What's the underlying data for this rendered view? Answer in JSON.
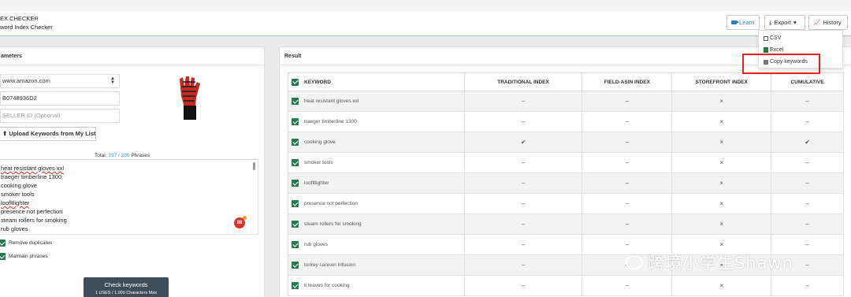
{
  "header": {
    "title": "EX CHECKER",
    "subtitle": "word Index Checker",
    "learn_label": "Learn",
    "export_label": "Export",
    "history_label": "History"
  },
  "export_menu": {
    "items": [
      "CSV",
      "Excel",
      "Copy keywords"
    ]
  },
  "parameters": {
    "title": "ameters",
    "marketplace": "www.amazon.com",
    "asin": "B0748936D2",
    "seller_placeholder": "SELLER ID (Optional)",
    "upload_label": "Upload Keywords from My List",
    "total_prefix": "Total:",
    "total_used": "197",
    "total_sep": " / ",
    "total_max": "200",
    "total_suffix": "Phrases",
    "keywords_text": [
      "heat resistant gloves xxl",
      "traeger timberline 1300",
      "cooking glove",
      "smoker tools",
      "loofltlighter",
      "presence not perfection",
      "steam rollers for smoking",
      "rub gloves"
    ],
    "badge": "88",
    "remove_duplicates_label": "Remove duplicates",
    "maintain_phrases_label": "Maintain phrases",
    "check_button": {
      "label": "Check keywords",
      "sublabel": "1 USES / 1,000 Characters Max"
    }
  },
  "result": {
    "title": "Result",
    "columns": [
      "KEYWORD",
      "TRADITIONAL INDEX",
      "FIELD-ASIN INDEX",
      "STOREFRONT INDEX",
      "CUMULATIVE"
    ],
    "rows": [
      {
        "keyword": "heat resistant gloves xxl",
        "traditional": "–",
        "field_asin": "–",
        "storefront": "×",
        "cumulative": "–"
      },
      {
        "keyword": "traeger timberline 1300",
        "traditional": "–",
        "field_asin": "–",
        "storefront": "×",
        "cumulative": "–"
      },
      {
        "keyword": "cooking glove",
        "traditional": "✔",
        "field_asin": "–",
        "storefront": "×",
        "cumulative": "✔"
      },
      {
        "keyword": "smoker tools",
        "traditional": "–",
        "field_asin": "–",
        "storefront": "×",
        "cumulative": "–"
      },
      {
        "keyword": "loofltlighter",
        "traditional": "–",
        "field_asin": "–",
        "storefront": "×",
        "cumulative": "–"
      },
      {
        "keyword": "presence not perfection",
        "traditional": "–",
        "field_asin": "–",
        "storefront": "×",
        "cumulative": "–"
      },
      {
        "keyword": "steam rollers for smoking",
        "traditional": "–",
        "field_asin": "–",
        "storefront": "×",
        "cumulative": "–"
      },
      {
        "keyword": "rub gloves",
        "traditional": "–",
        "field_asin": "–",
        "storefront": "×",
        "cumulative": "–"
      },
      {
        "keyword": "turkey cannon infusion",
        "traditional": "–",
        "field_asin": "–",
        "storefront": "×",
        "cumulative": "–"
      },
      {
        "keyword": "ti leaves for cooking",
        "traditional": "–",
        "field_asin": "–",
        "storefront": "×",
        "cumulative": "–"
      }
    ]
  },
  "watermark": "跨境小学生Shawn",
  "colors": {
    "checkbox_green": "#26784f",
    "accent_blue": "#2a9fd6",
    "highlight_red": "#e8231f",
    "check_button_bg": "#3e4d5a"
  }
}
